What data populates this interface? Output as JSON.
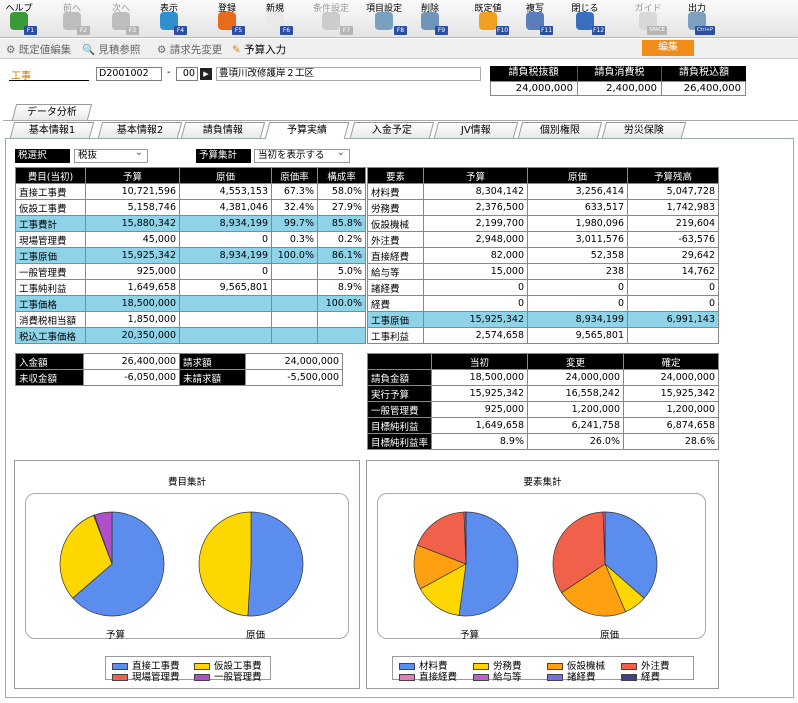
{
  "toolbar": [
    {
      "label": "ヘルプ",
      "fkey": "F1",
      "icon": "help-icon",
      "color": "#3a9a3a",
      "disabled": false
    },
    {
      "label": "前へ",
      "fkey": "F2",
      "icon": "arrow-left-icon",
      "color": "#bdbdbd",
      "disabled": true
    },
    {
      "label": "次へ",
      "fkey": "F3",
      "icon": "arrow-right-icon",
      "color": "#bdbdbd",
      "disabled": true
    },
    {
      "label": "表示",
      "fkey": "F4",
      "icon": "magnifier-icon",
      "color": "#2f8fcf",
      "disabled": false
    },
    {
      "label": "登録",
      "fkey": "F5",
      "icon": "ok-icon",
      "color": "#e86a1a",
      "disabled": false
    },
    {
      "label": "新規",
      "fkey": "F6",
      "icon": "new-document-icon",
      "color": "#e9e9e9",
      "disabled": false
    },
    {
      "label": "条件設定",
      "fkey": "F7",
      "icon": "condition-search-icon",
      "color": "#cccccc",
      "disabled": true
    },
    {
      "label": "項目設定",
      "fkey": "F8",
      "icon": "item-settings-icon",
      "color": "#7aa0c0",
      "disabled": false
    },
    {
      "label": "削除",
      "fkey": "F9",
      "icon": "trash-icon",
      "color": "#6f95b8",
      "disabled": false
    },
    {
      "label": "既定値",
      "fkey": "F10",
      "icon": "refresh-icon",
      "color": "#f0a020",
      "disabled": false
    },
    {
      "label": "複写",
      "fkey": "F11",
      "icon": "copy-icon",
      "color": "#5a7fb8",
      "disabled": false
    },
    {
      "label": "閉じる",
      "fkey": "F12",
      "icon": "close-door-icon",
      "color": "#3a6fc0",
      "disabled": false
    },
    {
      "label": "ガイド",
      "fkey": "SPACE",
      "icon": "guide-lightbulb-icon",
      "color": "#d8d8d8",
      "disabled": true
    },
    {
      "label": "出力",
      "fkey": "Ctrl+P",
      "icon": "printer-icon",
      "color": "#7f9fbf",
      "disabled": false
    }
  ],
  "subbar": {
    "items": [
      "既定値編集",
      "見積参照",
      "請求先変更",
      "予算入力"
    ],
    "edit_button": "編集"
  },
  "header": {
    "koji_label": "工事",
    "koji_code": "D2001002",
    "sep": "-",
    "branch": "00",
    "koji_name": "豊頃川改修護岸２工区",
    "totals_headers": [
      "請負税抜額",
      "請負消費税",
      "請負税込額"
    ],
    "totals_values": [
      "24,000,000",
      "2,400,000",
      "26,400,000"
    ]
  },
  "tabs": {
    "upper": "データ分析",
    "lower": [
      "基本情報1",
      "基本情報2",
      "請負情報",
      "予算実績",
      "入金予定",
      "JV情報",
      "個別権限",
      "労災保険"
    ],
    "active_index": 3
  },
  "filters": {
    "tax_label": "税選択",
    "tax_value": "税抜",
    "budget_label": "予算集計",
    "budget_value": "当初を表示する"
  },
  "left_table": {
    "headers": [
      "費目(当初)",
      "予算",
      "原価",
      "原価率",
      "構成率"
    ],
    "rows": [
      {
        "cells": [
          "直接工事費",
          "10,721,596",
          "4,553,153",
          "67.3%",
          "58.0%"
        ],
        "hl": false
      },
      {
        "cells": [
          "仮設工事費",
          "5,158,746",
          "4,381,046",
          "32.4%",
          "27.9%"
        ],
        "hl": false
      },
      {
        "cells": [
          "工事費計",
          "15,880,342",
          "8,934,199",
          "99.7%",
          "85.8%"
        ],
        "hl": true
      },
      {
        "cells": [
          "現場管理費",
          "45,000",
          "0",
          "0.3%",
          "0.2%"
        ],
        "hl": false
      },
      {
        "cells": [
          "工事原価",
          "15,925,342",
          "8,934,199",
          "100.0%",
          "86.1%"
        ],
        "hl": true
      },
      {
        "cells": [
          "一般管理費",
          "925,000",
          "0",
          "",
          "5.0%"
        ],
        "hl": false
      },
      {
        "cells": [
          "工事純利益",
          "1,649,658",
          "9,565,801",
          "",
          "8.9%"
        ],
        "hl": false
      },
      {
        "cells": [
          "工事価格",
          "18,500,000",
          "",
          "",
          "100.0%"
        ],
        "hl": true
      },
      {
        "cells": [
          "消費税相当額",
          "1,850,000",
          "",
          "",
          ""
        ],
        "hl": false
      },
      {
        "cells": [
          "税込工事価格",
          "20,350,000",
          "",
          "",
          ""
        ],
        "hl": true
      }
    ]
  },
  "right_table": {
    "headers": [
      "要素",
      "予算",
      "原価",
      "予算残高"
    ],
    "rows": [
      {
        "cells": [
          "材料費",
          "8,304,142",
          "3,256,414",
          "5,047,728"
        ],
        "hl": false
      },
      {
        "cells": [
          "労務費",
          "2,376,500",
          "633,517",
          "1,742,983"
        ],
        "hl": false
      },
      {
        "cells": [
          "仮設機械",
          "2,199,700",
          "1,980,096",
          "219,604"
        ],
        "hl": false
      },
      {
        "cells": [
          "外注費",
          "2,948,000",
          "3,011,576",
          "-63,576"
        ],
        "hl": false
      },
      {
        "cells": [
          "直接経費",
          "82,000",
          "52,358",
          "29,642"
        ],
        "hl": false
      },
      {
        "cells": [
          "給与等",
          "15,000",
          "238",
          "14,762"
        ],
        "hl": false
      },
      {
        "cells": [
          "諸経費",
          "0",
          "0",
          "0"
        ],
        "hl": false
      },
      {
        "cells": [
          "経費",
          "0",
          "0",
          "0"
        ],
        "hl": false
      },
      {
        "cells": [
          "工事原価",
          "15,925,342",
          "8,934,199",
          "6,991,143"
        ],
        "hl": true
      },
      {
        "cells": [
          "工事利益",
          "2,574,658",
          "9,565,801",
          ""
        ],
        "hl": false
      }
    ]
  },
  "payment_table": {
    "rows": [
      [
        "入金額",
        "26,400,000",
        "請求額",
        "24,000,000"
      ],
      [
        "未収金額",
        "-6,050,000",
        "未請求額",
        "-5,500,000"
      ]
    ]
  },
  "budget_table": {
    "headers": [
      "",
      "当初",
      "変更",
      "確定"
    ],
    "rows": [
      [
        "請負金額",
        "18,500,000",
        "24,000,000",
        "24,000,000"
      ],
      [
        "実行予算",
        "15,925,342",
        "16,558,242",
        "15,925,342"
      ],
      [
        "一般管理費",
        "925,000",
        "1,200,000",
        "1,200,000"
      ],
      [
        "目標純利益",
        "1,649,658",
        "6,241,758",
        "6,874,658"
      ],
      [
        "目標純利益率",
        "8.9%",
        "26.0%",
        "28.6%"
      ]
    ]
  },
  "charts": {
    "left_title": "費目集計",
    "right_title": "要素集計",
    "pie_labels": [
      "予算",
      "原価"
    ]
  },
  "chart_data": [
    {
      "type": "pie",
      "title": "費目集計",
      "categories": [
        "直接工事費",
        "仮設工事費",
        "現場管理費",
        "一般管理費"
      ],
      "colors": [
        "#5b8def",
        "#ffd700",
        "#f0604a",
        "#b04fc8"
      ],
      "series": [
        {
          "name": "予算",
          "values": [
            10721596,
            5158746,
            45000,
            925000
          ]
        },
        {
          "name": "原価",
          "values": [
            4553153,
            4381046,
            0,
            0
          ]
        }
      ]
    },
    {
      "type": "pie",
      "title": "要素集計",
      "categories": [
        "材料費",
        "労務費",
        "仮設機械",
        "外注費",
        "直接経費",
        "給与等",
        "諸経費",
        "経費"
      ],
      "colors": [
        "#5b8def",
        "#ffd700",
        "#ffa010",
        "#f0604a",
        "#e879c0",
        "#c060d0",
        "#7070e0",
        "#404090"
      ],
      "series": [
        {
          "name": "予算",
          "values": [
            8304142,
            2376500,
            2199700,
            2948000,
            82000,
            15000,
            0,
            0
          ]
        },
        {
          "name": "原価",
          "values": [
            3256414,
            633517,
            1980096,
            3011576,
            52358,
            238,
            0,
            0
          ]
        }
      ]
    }
  ]
}
